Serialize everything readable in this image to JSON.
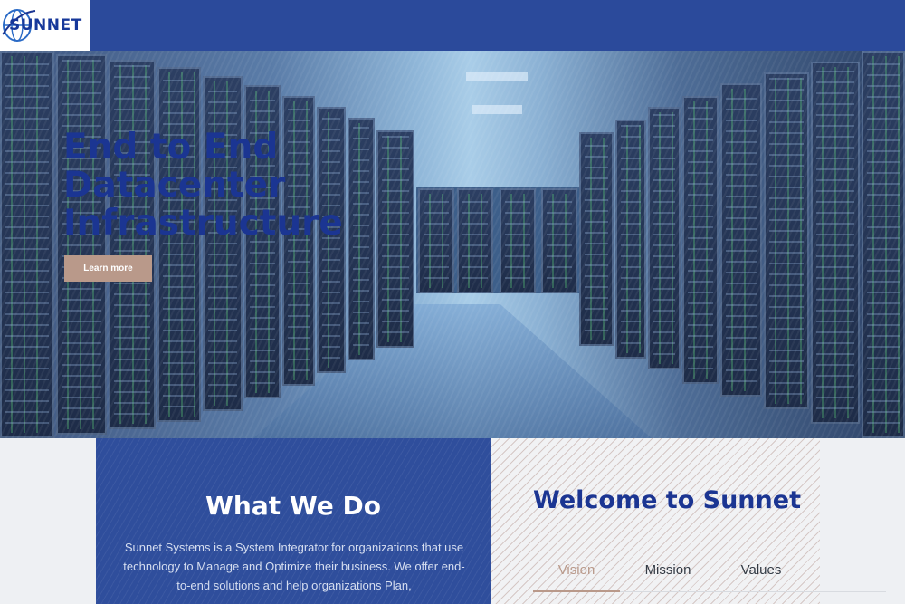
{
  "brand": {
    "logo_text": "SUNNET"
  },
  "hero": {
    "title": "End to End Datacenter Infrastructure",
    "cta_label": "Learn more"
  },
  "what_we_do": {
    "title": "What We Do",
    "body": "Sunnet Systems is a System Integrator for organizations that use technology to Manage and Optimize their business. We offer end-to-end solutions and help organizations Plan,"
  },
  "welcome": {
    "title": "Welcome to Sunnet",
    "tabs": [
      {
        "label": "Vision",
        "active": true
      },
      {
        "label": "Mission",
        "active": false
      },
      {
        "label": "Values",
        "active": false
      }
    ]
  },
  "colors": {
    "brand_blue": "#2b4a9b",
    "heading_blue": "#1b3592",
    "accent_tan": "#b9998a"
  }
}
